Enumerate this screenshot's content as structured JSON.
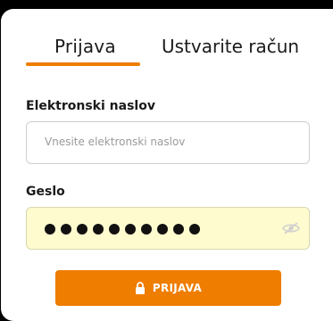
{
  "tabs": {
    "login": "Prijava",
    "register": "Ustvarite račun"
  },
  "form": {
    "email_label": "Elektronski naslov",
    "email_placeholder": "Vnesite elektronski naslov",
    "password_label": "Geslo",
    "password_mask_count": 10,
    "submit_label": "PRIJAVA"
  },
  "icons": {
    "submit": "lock-icon",
    "password_toggle": "eye-slash-icon"
  },
  "colors": {
    "accent": "#ee7d00",
    "autofill_background": "#fefccf"
  }
}
